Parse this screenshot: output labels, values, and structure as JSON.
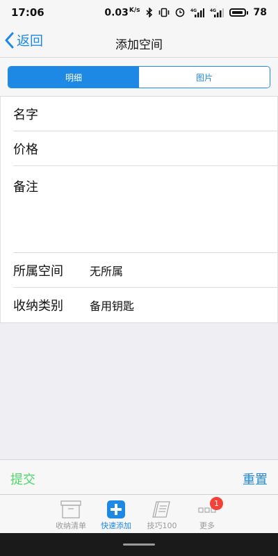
{
  "status_bar": {
    "time": "17:06",
    "speed": "0.03",
    "speed_unit": "K/s",
    "battery": "78",
    "icons": [
      "bluetooth-icon",
      "vibrate-icon",
      "alarm-icon",
      "signal-4g-icon",
      "signal-icon",
      "battery-icon"
    ]
  },
  "nav": {
    "back_label": "返回",
    "title": "添加空间"
  },
  "segment": {
    "tabs": [
      "明细",
      "图片"
    ],
    "selected": 0
  },
  "form": {
    "name_label": "名字",
    "price_label": "价格",
    "note_label": "备注",
    "space_label": "所属空间",
    "space_value": "无所属",
    "type_label": "收纳类别",
    "type_value": "备用钥匙"
  },
  "actions": {
    "submit": "提交",
    "reset": "重置"
  },
  "tabbar": {
    "items": [
      {
        "label": "收纳清单",
        "icon": "box-icon"
      },
      {
        "label": "快速添加",
        "icon": "plus-square-icon"
      },
      {
        "label": "技巧100",
        "icon": "book-icon"
      },
      {
        "label": "更多",
        "icon": "more-icon",
        "badge": "1"
      }
    ],
    "active": 1
  },
  "colors": {
    "accent": "#1e88e5",
    "submit": "#4cd964",
    "badge": "#f44336",
    "background": "#efeef3"
  }
}
